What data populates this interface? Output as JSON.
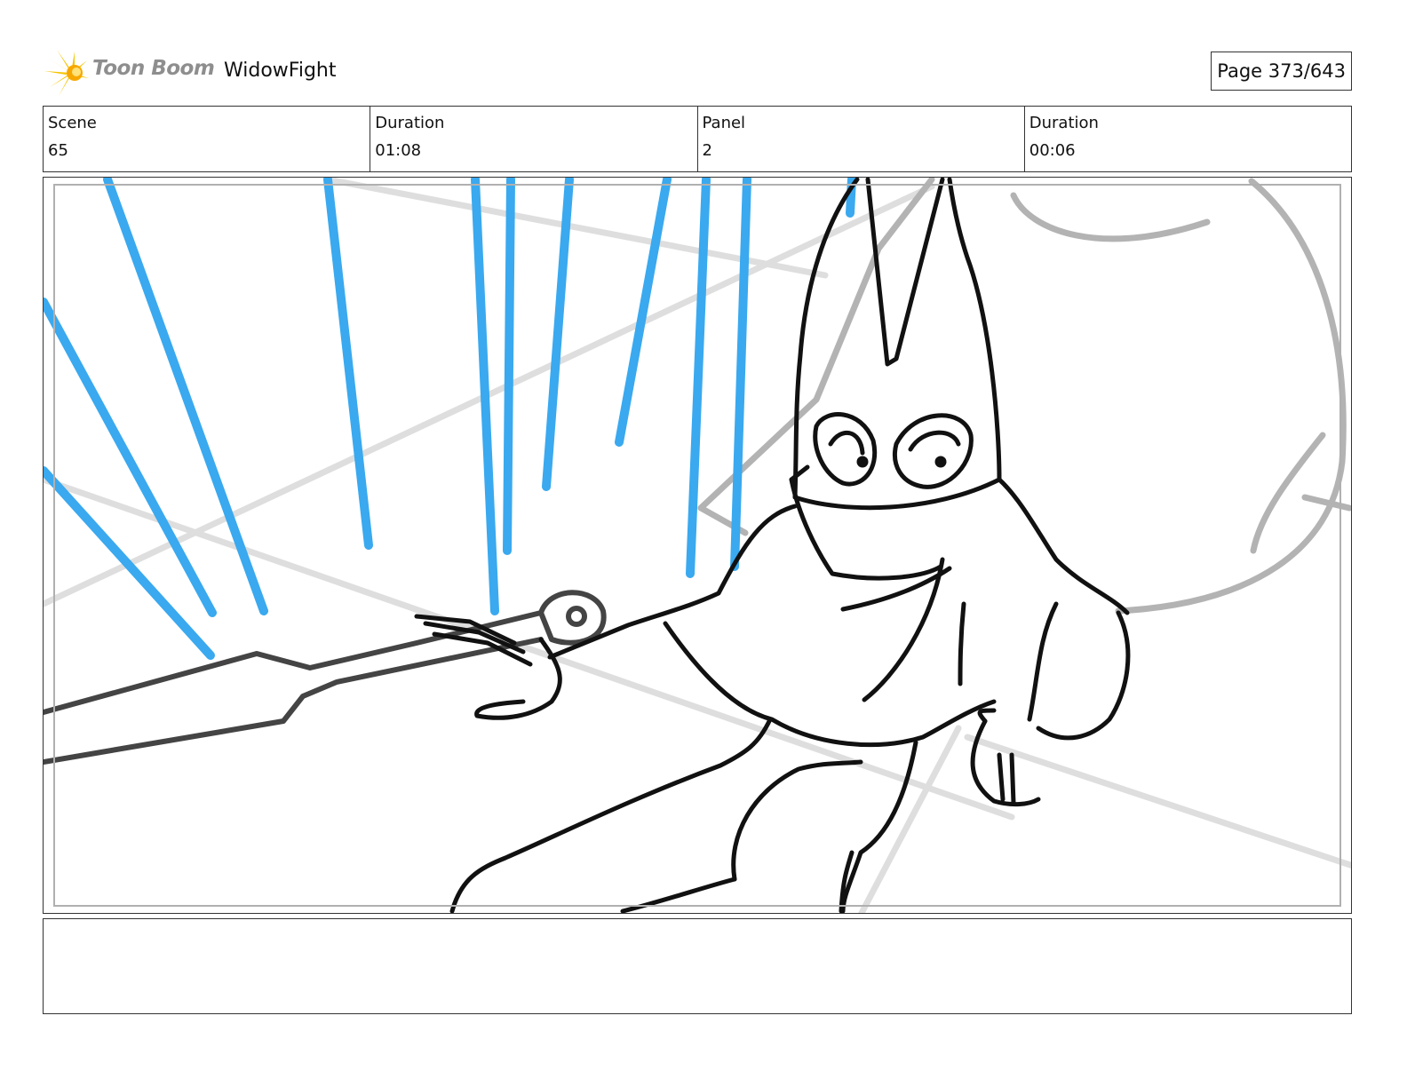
{
  "header": {
    "logo_text": "Toon Boom",
    "project_title": "WidowFight",
    "page_label": "Page 373/643"
  },
  "info": [
    {
      "label": "Scene",
      "value": "65"
    },
    {
      "label": "Duration",
      "value": "01:08"
    },
    {
      "label": "Panel",
      "value": "2"
    },
    {
      "label": "Duration",
      "value": "00:06"
    }
  ],
  "panel": {
    "image_icon": "storyboard-drawing",
    "colors": {
      "ink": "#111111",
      "blue": "#3aa9ef",
      "grey": "#b3b3b3",
      "light_grey": "#d9d9d9",
      "dark_grey": "#444444"
    }
  },
  "notes": {
    "text": ""
  },
  "colors": {
    "logo_yellow": "#f5c400",
    "logo_text": "#8e8e8e",
    "border": "#333333"
  }
}
